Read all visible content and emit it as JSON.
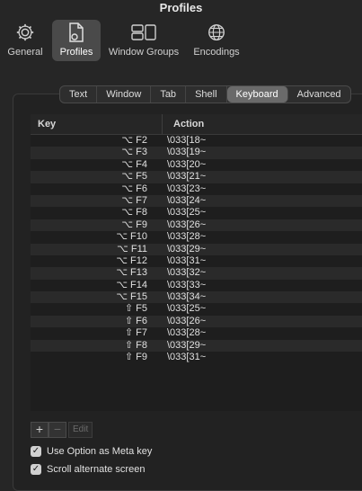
{
  "window": {
    "title": "Profiles"
  },
  "toolbar": {
    "items": [
      {
        "label": "General",
        "icon": "gear-icon"
      },
      {
        "label": "Profiles",
        "icon": "profiles-doc-icon",
        "active": true
      },
      {
        "label": "Window Groups",
        "icon": "window-groups-icon"
      },
      {
        "label": "Encodings",
        "icon": "globe-icon"
      }
    ]
  },
  "tabs": [
    "Text",
    "Window",
    "Tab",
    "Shell",
    "Keyboard",
    "Advanced"
  ],
  "active_tab": "Keyboard",
  "table": {
    "headers": {
      "key": "Key",
      "action": "Action"
    },
    "rows": [
      {
        "key": "⌥ F2",
        "action": "\\033[18~"
      },
      {
        "key": "⌥ F3",
        "action": "\\033[19~"
      },
      {
        "key": "⌥ F4",
        "action": "\\033[20~"
      },
      {
        "key": "⌥ F5",
        "action": "\\033[21~"
      },
      {
        "key": "⌥ F6",
        "action": "\\033[23~"
      },
      {
        "key": "⌥ F7",
        "action": "\\033[24~"
      },
      {
        "key": "⌥ F8",
        "action": "\\033[25~"
      },
      {
        "key": "⌥ F9",
        "action": "\\033[26~"
      },
      {
        "key": "⌥ F10",
        "action": "\\033[28~"
      },
      {
        "key": "⌥ F11",
        "action": "\\033[29~"
      },
      {
        "key": "⌥ F12",
        "action": "\\033[31~"
      },
      {
        "key": "⌥ F13",
        "action": "\\033[32~"
      },
      {
        "key": "⌥ F14",
        "action": "\\033[33~"
      },
      {
        "key": "⌥ F15",
        "action": "\\033[34~"
      },
      {
        "key": "⇧ F5",
        "action": "\\033[25~"
      },
      {
        "key": "⇧ F6",
        "action": "\\033[26~"
      },
      {
        "key": "⇧ F7",
        "action": "\\033[28~"
      },
      {
        "key": "⇧ F8",
        "action": "\\033[29~"
      },
      {
        "key": "⇧ F9",
        "action": "\\033[31~"
      }
    ]
  },
  "buttons": {
    "add": "+",
    "remove": "−",
    "edit": "Edit"
  },
  "options": {
    "meta_key": {
      "label": "Use Option as Meta key",
      "checked": true
    },
    "scroll_alt": {
      "label": "Scroll alternate screen",
      "checked": true
    }
  },
  "colors": {
    "background": "#262626",
    "active_tab": "#6a6a6a",
    "row_alt": "#2a2a2a"
  }
}
